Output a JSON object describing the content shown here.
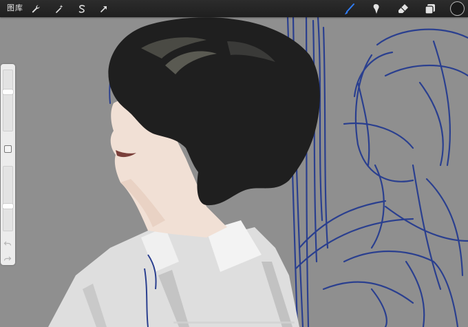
{
  "toolbar": {
    "gallery_label": "图库",
    "left_tools": [
      "wrench-icon",
      "magic-wand-icon",
      "selection-icon",
      "transform-arrow-icon"
    ],
    "right_tools": [
      "brush-icon",
      "smudge-icon",
      "eraser-icon",
      "layers-icon"
    ],
    "active_tool": "brush-icon",
    "active_color": "#1a1a1a",
    "accent_color": "#2f7cf6"
  },
  "sidebar": {
    "brush_size_level": 0.65,
    "opacity_level": 0.38
  },
  "canvas": {
    "background": "#8f8f8f",
    "sketch_color": "#2a3f8f",
    "hair_color": "#1f1f1f",
    "skin_color": "#f1e0d5",
    "shirt_color": "#dedede"
  }
}
